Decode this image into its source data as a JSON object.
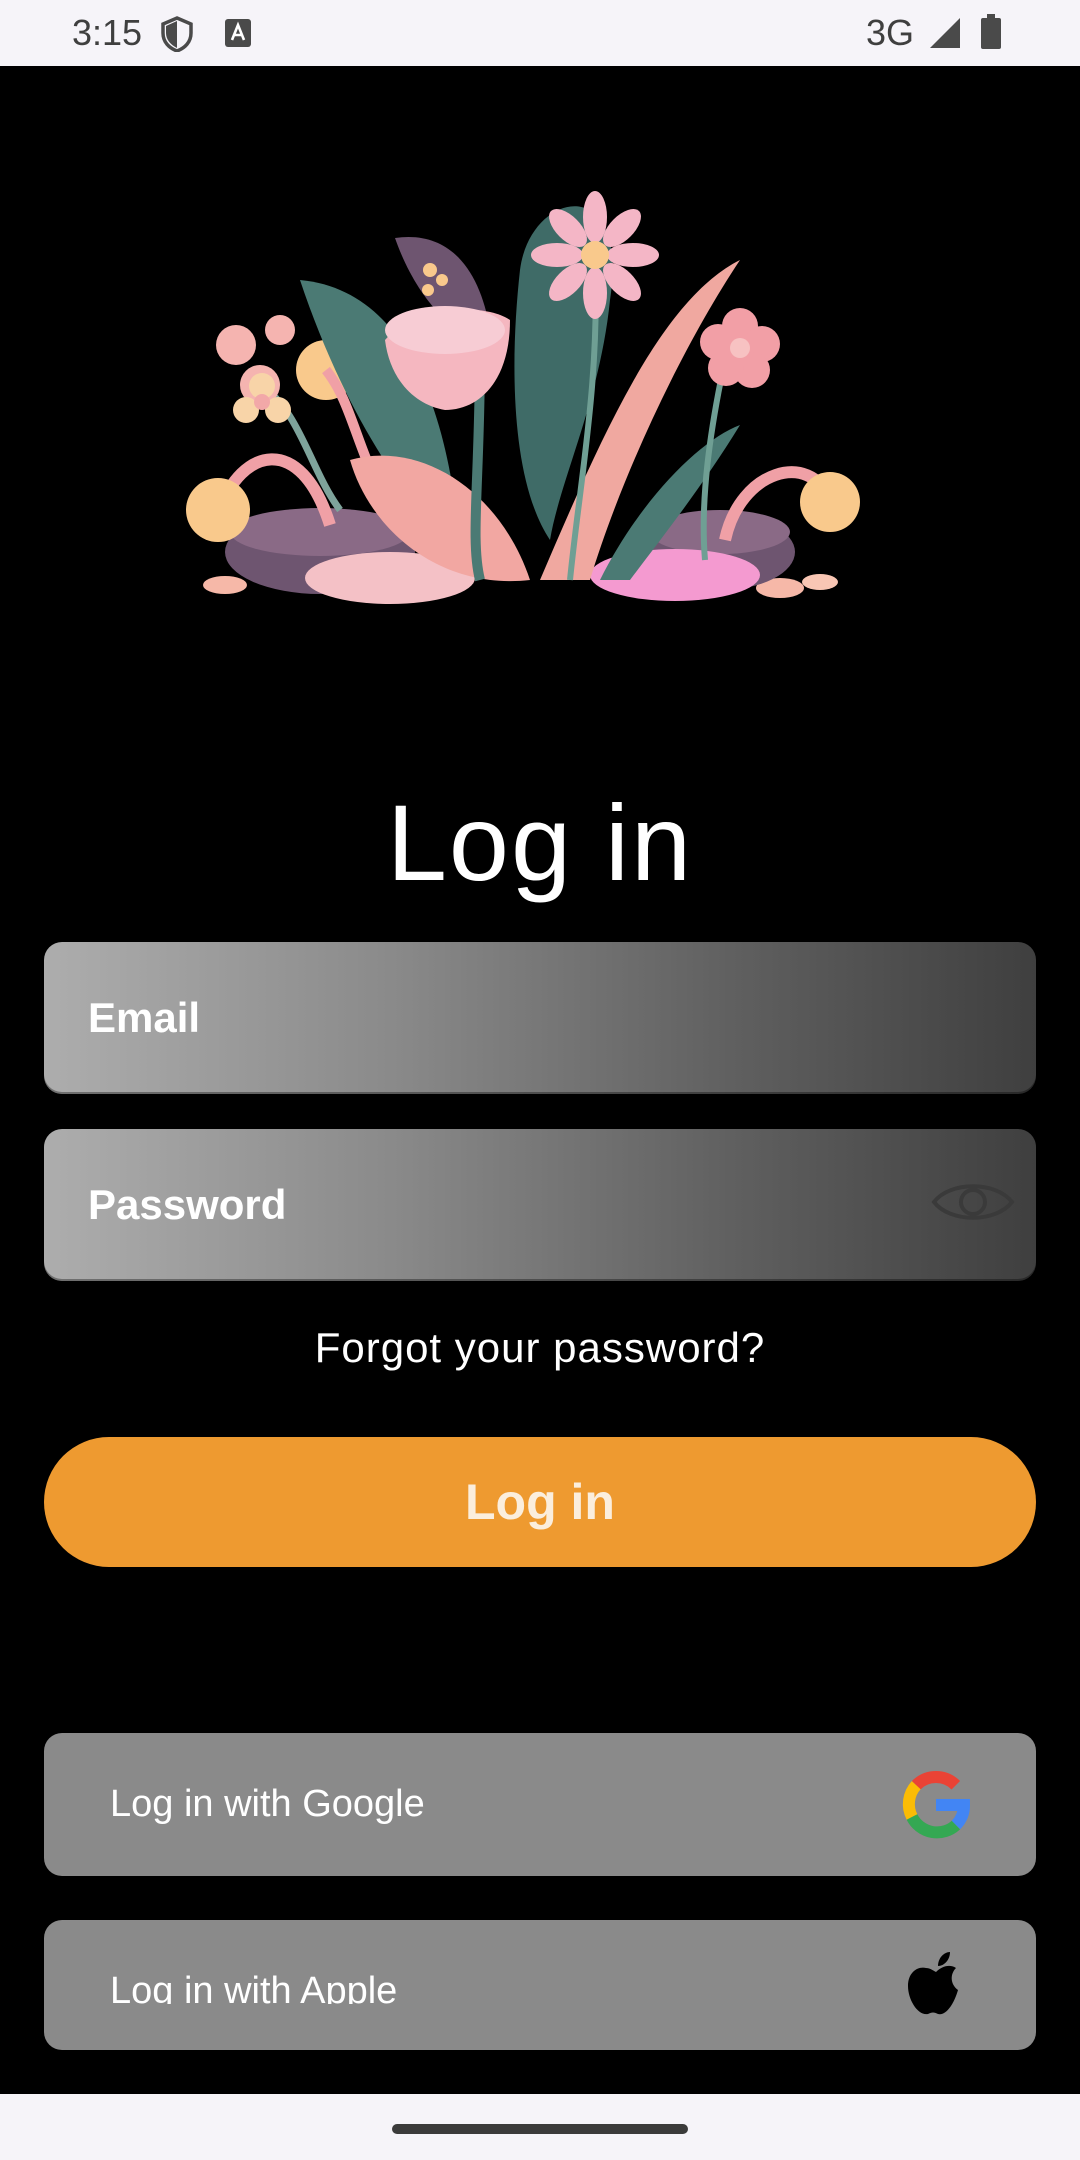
{
  "status_bar": {
    "time": "3:15",
    "network": "3G",
    "icons": [
      "shield-icon",
      "keyboard-a-icon",
      "signal-icon",
      "battery-icon"
    ]
  },
  "hero": {
    "illustration": "flowers-illustration"
  },
  "login": {
    "title": "Log in",
    "email_placeholder": "Email",
    "password_placeholder": "Password",
    "forgot_password": "Forgot your password?",
    "submit_label": "Log in"
  },
  "social": {
    "google_label": "Log in with Google",
    "apple_label": "Log in with Apple"
  },
  "colors": {
    "background": "#000000",
    "accent": "#ee9a30",
    "social_button": "#8a8a8a",
    "system_bar": "#f6f4f9"
  }
}
